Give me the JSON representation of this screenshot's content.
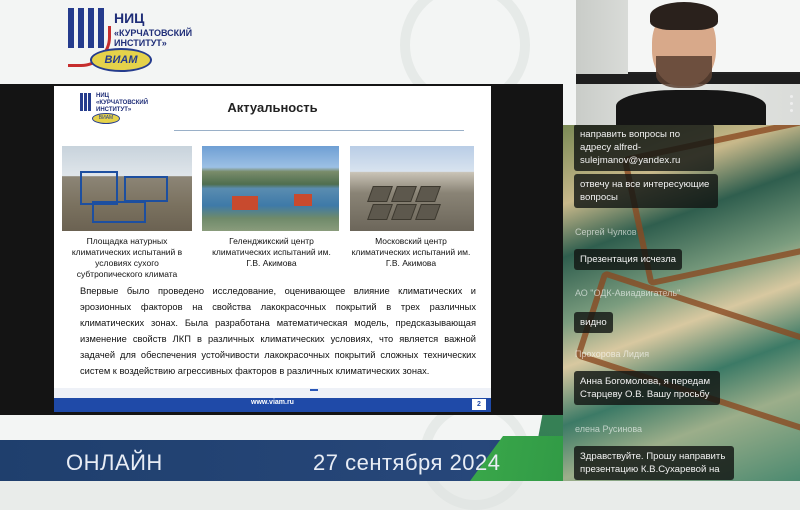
{
  "header": {
    "logo_line1": "НИЦ",
    "logo_line2": "«КУРЧАТОВСКИЙ ИНСТИТУТ»",
    "logo_badge": "ВИАМ"
  },
  "footer": {
    "online": "ОНЛАЙН",
    "date": "27 сентября 2024"
  },
  "slide": {
    "logo_line1": "НИЦ",
    "logo_line2": "«КУРЧАТОВСКИЙ ИНСТИТУТ»",
    "logo_badge": "ВИАМ",
    "title": "Актуальность",
    "captions": [
      "Площадка натурных климатических испытаний в условиях сухого субтропического климата",
      "Геленджикский центр климатических испытаний им. Г.В. Акимова",
      "Московский центр климатических испытаний им. Г.В. Акимова"
    ],
    "body": "Впервые было проведено исследование, оценивающее влияние климатических и эрозионных факторов на свойства лакокрасочных покрытий в трех различных климатических зонах. Была разработана математическая модель, предсказывающая изменение свойств ЛКП в различных климатических условиях, что является важной задачей для обеспечения устойчивости лакокрасочных покрытий сложных технических систем к воздействию агрессивных факторов в различных климатических зонах.",
    "url": "www.viam.ru",
    "page": "2"
  },
  "chat": {
    "messages": [
      {
        "text": "направить вопросы по адресу alfred-sulejmanov@yandex.ru"
      },
      {
        "text": "отвечу на все интересующие вопросы"
      },
      {
        "author": "Сергей Чулков",
        "text": "Презентация исчезла"
      },
      {
        "author": "АО \"ОДК-Авиадвигатель\"",
        "text": "видно"
      },
      {
        "author": "Прохорова Лидия",
        "text": "Анна Богомолова, я передам Старцеву О.В. Вашу просьбу"
      },
      {
        "author": "елена Русинова",
        "text": "Здравствуйте. Прошу направить презентацию К.В.Сухаревой на"
      }
    ]
  }
}
